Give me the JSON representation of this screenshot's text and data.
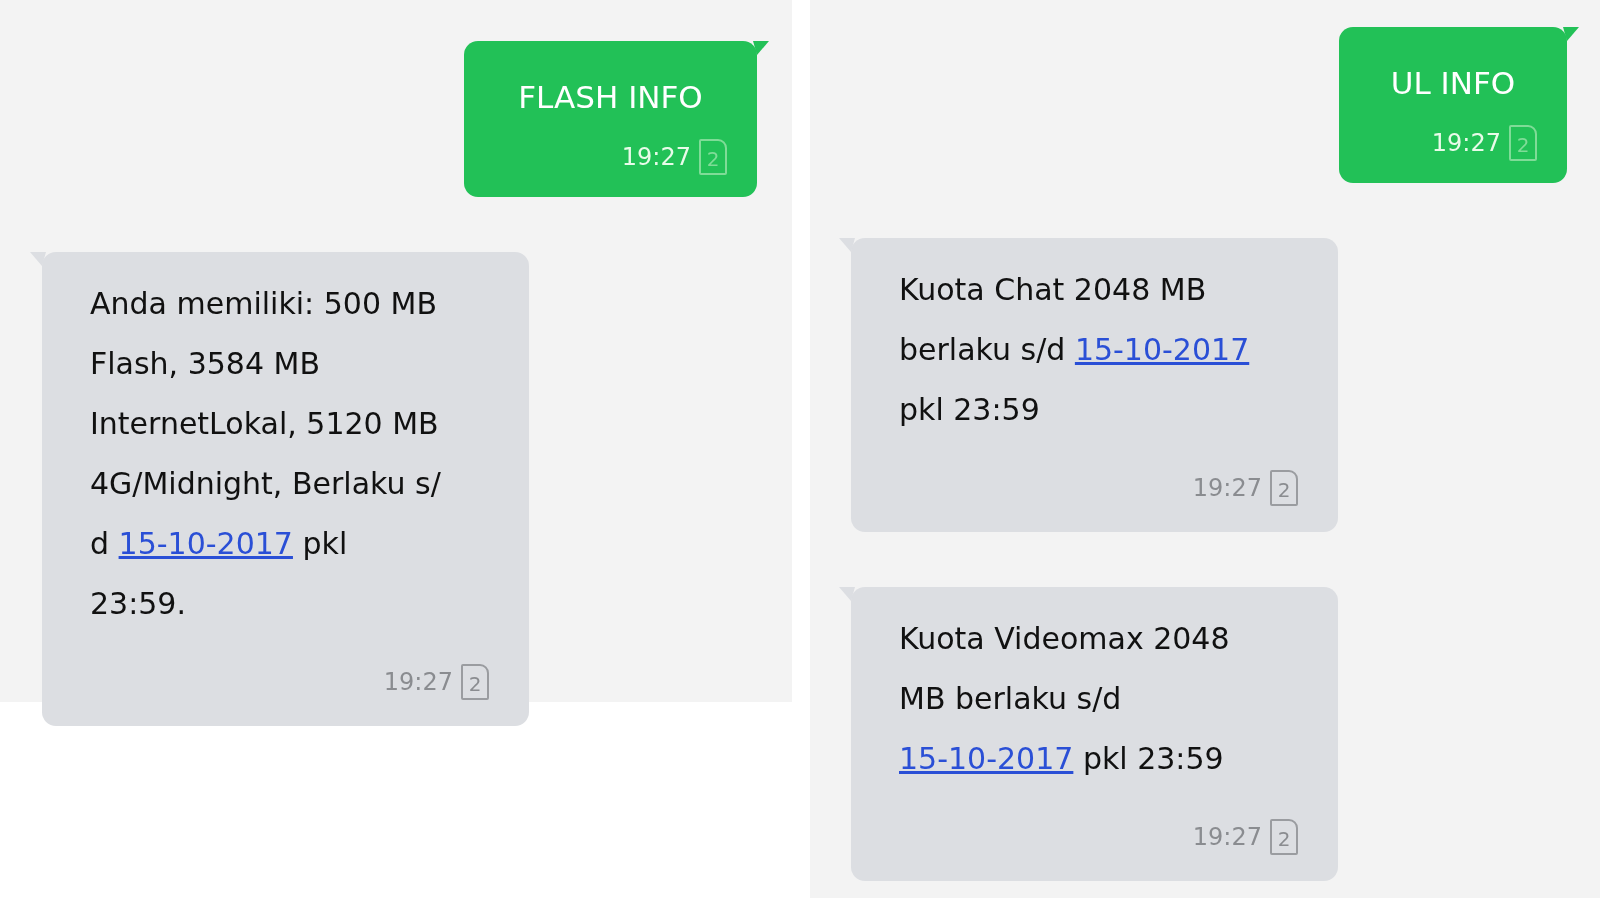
{
  "panels": [
    {
      "messages": [
        {
          "kind": "sent",
          "body": [
            {
              "kind": "text",
              "text": "FLASH INFO"
            }
          ],
          "time": "19:27",
          "sim": "2"
        },
        {
          "kind": "received",
          "body": [
            {
              "kind": "text",
              "text": "Anda memiliki: 500 MB Flash, 3584 MB InternetLokal, 5120 MB 4G/Midnight,  Berlaku s/ d "
            },
            {
              "kind": "link",
              "text": "15-10-2017"
            },
            {
              "kind": "text",
              "text": " pkl 23:59."
            }
          ],
          "time": "19:27",
          "sim": "2"
        }
      ]
    },
    {
      "messages": [
        {
          "kind": "sent",
          "body": [
            {
              "kind": "text",
              "text": "UL INFO"
            }
          ],
          "time": "19:27",
          "sim": "2"
        },
        {
          "kind": "received",
          "body": [
            {
              "kind": "text",
              "text": "Kuota Chat 2048 MB berlaku s/d "
            },
            {
              "kind": "link",
              "text": "15-10-2017"
            },
            {
              "kind": "text",
              "text": " pkl 23:59"
            }
          ],
          "time": "19:27",
          "sim": "2"
        },
        {
          "kind": "received",
          "body": [
            {
              "kind": "text",
              "text": "Kuota Videomax 2048 MB berlaku s/d "
            },
            {
              "kind": "link",
              "text": "15-10-2017"
            },
            {
              "kind": "text",
              "text": " pkl 23:59"
            }
          ],
          "time": "19:27",
          "sim": "2"
        }
      ]
    }
  ]
}
